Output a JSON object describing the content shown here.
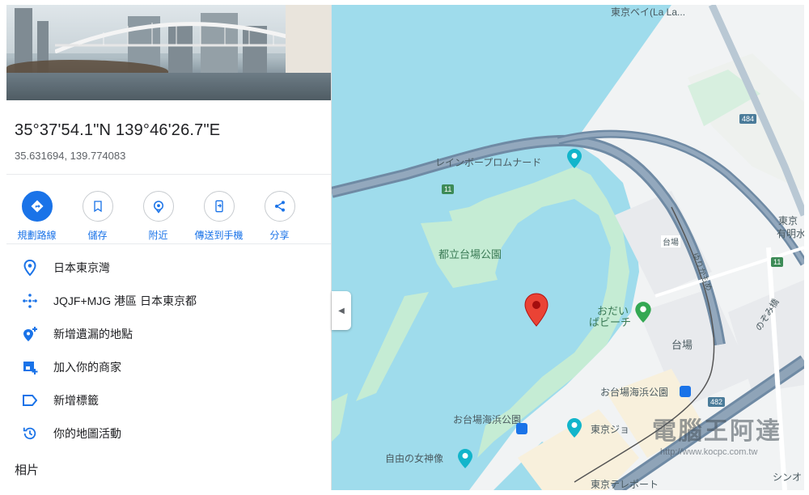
{
  "place": {
    "dms": "35°37'54.1\"N 139°46'26.7\"E",
    "decimal": "35.631694, 139.774083"
  },
  "actions": [
    {
      "label": "規劃路線",
      "icon": "directions-icon"
    },
    {
      "label": "儲存",
      "icon": "bookmark-icon"
    },
    {
      "label": "附近",
      "icon": "nearby-icon"
    },
    {
      "label": "傳送到手機",
      "icon": "send-to-phone-icon"
    },
    {
      "label": "分享",
      "icon": "share-icon"
    }
  ],
  "details": [
    {
      "text": "日本東京灣",
      "icon": "location-pin-icon"
    },
    {
      "text": "JQJF+MJG 港區 日本東京都",
      "icon": "plus-code-icon"
    },
    {
      "text": "新增遺漏的地點",
      "icon": "add-place-icon"
    },
    {
      "text": "加入你的商家",
      "icon": "add-business-icon"
    },
    {
      "text": "新增標籤",
      "icon": "label-icon"
    },
    {
      "text": "你的地圖活動",
      "icon": "history-icon"
    }
  ],
  "photos_heading": "相片",
  "map": {
    "labels": {
      "top_right": "東京ベイ(La La...",
      "rainbow": "レインボープロムナード",
      "park": "都立台場公園",
      "beach_1": "おだい",
      "beach_2": "ばビーチ",
      "daiba": "台場",
      "daiba_station": "台場",
      "daiba_park": "お台場海浜公園",
      "daiba_park_2": "お台場海浜公園",
      "liberty": "自由の女神像",
      "tokyo_right": "東京",
      "ariake": "有明水再",
      "nozomi": "のぞみ橋",
      "shinagawa": "シンオ",
      "tv": "東京テレポート",
      "tokyo_joy": "東京ジョ",
      "yurikamome": "ゆりかもめ"
    },
    "shields": {
      "r11a": "11",
      "r11b": "11",
      "r484": "484",
      "r482": "482"
    },
    "colors": {
      "water": "#9fdcec",
      "park": "#c5ecd4",
      "land": "#f1f3f4",
      "road": "#6f8aa4",
      "pin": "#ea4335"
    }
  },
  "watermark": {
    "title": "電腦王阿達",
    "url": "http://www.kocpc.com.tw"
  }
}
